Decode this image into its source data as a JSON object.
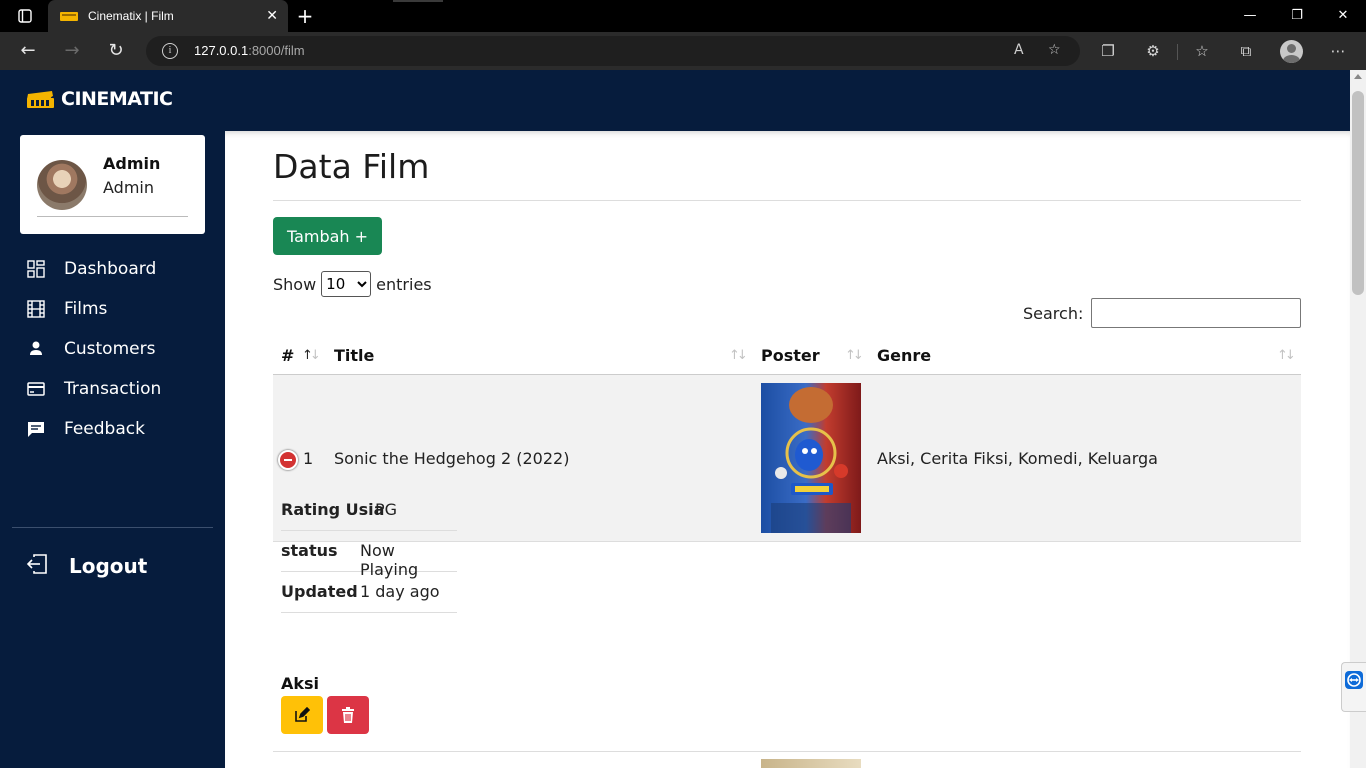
{
  "browser": {
    "tab_title": "Cinematix | Film",
    "url_host": "127.0.0.1",
    "url_rest": ":8000/film"
  },
  "app": {
    "brand": "CINEMATIC",
    "user": {
      "name": "Admin",
      "role": "Admin"
    },
    "menu": [
      {
        "label": "Dashboard",
        "icon": "dashboard-icon"
      },
      {
        "label": "Films",
        "icon": "film-icon"
      },
      {
        "label": "Customers",
        "icon": "person-icon"
      },
      {
        "label": "Transaction",
        "icon": "credit-card-icon"
      },
      {
        "label": "Feedback",
        "icon": "message-icon"
      }
    ],
    "logout": "Logout"
  },
  "page": {
    "title": "Data Film",
    "add_button": "Tambah +",
    "show_label": "Show",
    "entries_label": "entries",
    "page_size": "10",
    "search_label": "Search:",
    "search_value": ""
  },
  "table": {
    "columns": [
      "#",
      "Title",
      "Poster",
      "Genre"
    ],
    "rows": [
      {
        "no": "1",
        "title": "Sonic the Hedgehog 2 (2022)",
        "genre": "Aksi, Cerita Fiksi, Komedi, Keluarga",
        "details": {
          "rating_label": "Rating Usia",
          "rating_value": "PG",
          "status_label": "status",
          "status_value": "Now Playing",
          "updated_label": "Updated",
          "updated_value": "1 day ago",
          "aksi_label": "Aksi"
        }
      }
    ]
  },
  "colors": {
    "nav_bg": "#061c3d",
    "add_button": "#198754",
    "edit_button": "#ffc107",
    "delete_button": "#dc3545"
  }
}
